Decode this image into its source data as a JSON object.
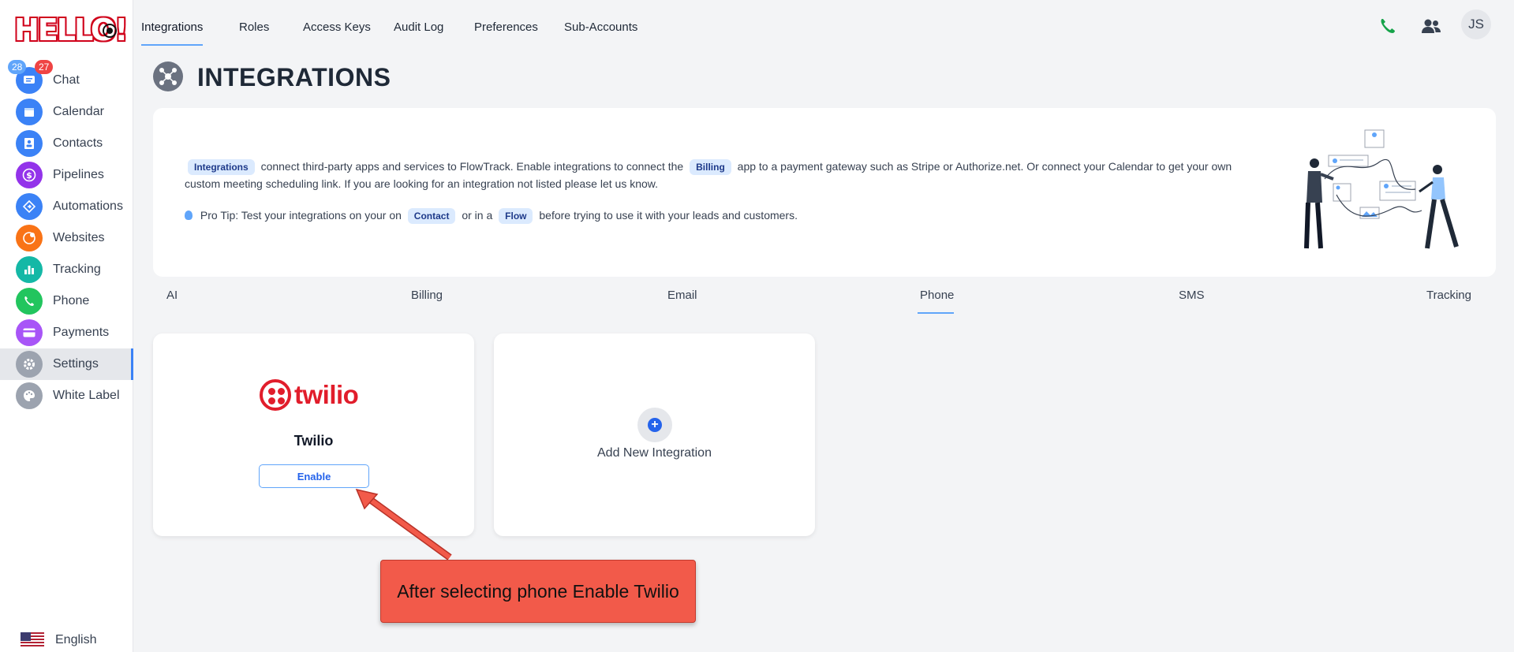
{
  "sidebar": {
    "logo": "HELLO!",
    "badges": {
      "blue": "28",
      "red": "27"
    },
    "items": [
      {
        "label": "Chat",
        "icon": "chat-icon",
        "color": "#3b82f6"
      },
      {
        "label": "Calendar",
        "icon": "calendar-icon",
        "color": "#3b82f6"
      },
      {
        "label": "Contacts",
        "icon": "contacts-icon",
        "color": "#3b82f6"
      },
      {
        "label": "Pipelines",
        "icon": "dollar-icon",
        "color": "#9333ea"
      },
      {
        "label": "Automations",
        "icon": "automation-icon",
        "color": "#3b82f6"
      },
      {
        "label": "Websites",
        "icon": "websites-icon",
        "color": "#f97316"
      },
      {
        "label": "Tracking",
        "icon": "tracking-icon",
        "color": "#14b8a6"
      },
      {
        "label": "Phone",
        "icon": "phone-icon",
        "color": "#22c55e"
      },
      {
        "label": "Payments",
        "icon": "payments-icon",
        "color": "#a855f7"
      },
      {
        "label": "Settings",
        "icon": "gear-icon",
        "color": "#9ca3af"
      },
      {
        "label": "White Label",
        "icon": "palette-icon",
        "color": "#9ca3af"
      }
    ],
    "language": "English"
  },
  "topnav": {
    "tabs": [
      "Integrations",
      "Roles",
      "Access Keys",
      "Audit Log",
      "Preferences",
      "Sub-Accounts"
    ],
    "avatar": "JS"
  },
  "header": {
    "title": "INTEGRATIONS"
  },
  "info": {
    "chip_integrations": "Integrations",
    "text1": "connect third-party apps and services to FlowTrack. Enable integrations to connect the",
    "chip_billing": "Billing",
    "text2": "app to a payment gateway such as Stripe or Authorize.net. Or connect your Calendar to get your own custom meeting scheduling link. If you are looking for an integration not listed please let us know.",
    "tip_prefix": "Pro Tip: Test your integrations on your on",
    "chip_contact": "Contact",
    "tip_mid": "or in a",
    "chip_flow": "Flow",
    "tip_suffix": "before trying to use it with your leads and customers."
  },
  "categories": [
    "AI",
    "Billing",
    "Email",
    "Phone",
    "SMS",
    "Tracking"
  ],
  "cards": {
    "twilio": {
      "logo_text": "twilio",
      "title": "Twilio",
      "button": "Enable"
    },
    "add_new": {
      "label": "Add New Integration"
    }
  },
  "annotation": {
    "text": "After selecting phone Enable Twilio"
  },
  "colors": {
    "accent": "#3b82f6",
    "twilio_red": "#e11d2b",
    "callout": "#f25a4a"
  }
}
